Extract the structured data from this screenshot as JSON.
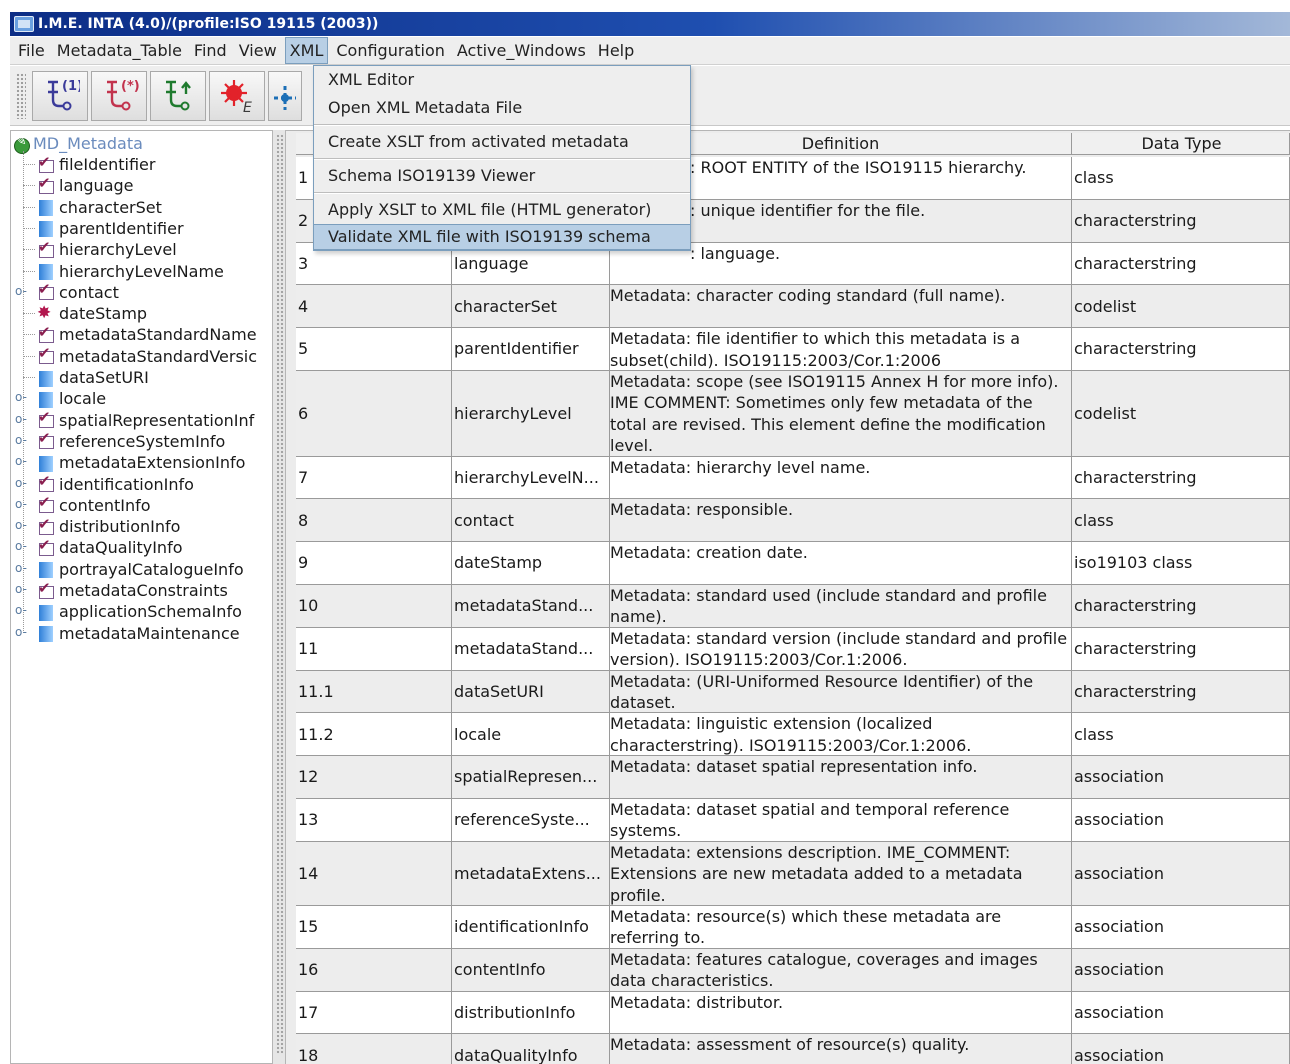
{
  "window": {
    "title": "I.M.E. INTA (4.0)/(profile:ISO 19115 (2003))"
  },
  "menubar": {
    "items": [
      "File",
      "Metadata_Table",
      "Find",
      "View",
      "XML",
      "Configuration",
      "Active_Windows",
      "Help"
    ]
  },
  "toolbar": {
    "buttons": [
      "tree-1-icon",
      "tree-star-icon",
      "tree-arrow-icon",
      "virus-e-icon",
      "network-icon"
    ]
  },
  "xml_menu": {
    "groups": [
      [
        "XML Editor",
        "Open XML Metadata File"
      ],
      [
        "Create XSLT from activated metadata"
      ],
      [
        "Schema ISO19139 Viewer"
      ],
      [
        "Apply XSLT to XML file (HTML generator)",
        "Validate XML file with ISO19139 schema"
      ]
    ],
    "highlighted": "Validate XML file with ISO19139 schema"
  },
  "tree": {
    "root": "MD_Metadata",
    "items": [
      {
        "label": "fileIdentifier",
        "icon": "check-icon",
        "expandable": false
      },
      {
        "label": "language",
        "icon": "check-icon",
        "expandable": false
      },
      {
        "label": "characterSet",
        "icon": "square-icon",
        "expandable": false
      },
      {
        "label": "parentIdentifier",
        "icon": "square-icon",
        "expandable": false
      },
      {
        "label": "hierarchyLevel",
        "icon": "check-icon",
        "expandable": false
      },
      {
        "label": "hierarchyLevelName",
        "icon": "square-icon",
        "expandable": false
      },
      {
        "label": "contact",
        "icon": "check-icon",
        "expandable": true
      },
      {
        "label": "dateStamp",
        "icon": "stamp-icon",
        "expandable": false
      },
      {
        "label": "metadataStandardName",
        "icon": "check-icon",
        "expandable": false
      },
      {
        "label": "metadataStandardVersic",
        "icon": "check-icon",
        "expandable": false
      },
      {
        "label": "dataSetURI",
        "icon": "square-icon",
        "expandable": false
      },
      {
        "label": "locale",
        "icon": "square-icon",
        "expandable": true
      },
      {
        "label": "spatialRepresentationInf",
        "icon": "check-icon",
        "expandable": true
      },
      {
        "label": "referenceSystemInfo",
        "icon": "check-icon",
        "expandable": true
      },
      {
        "label": "metadataExtensionInfo",
        "icon": "square-icon",
        "expandable": true
      },
      {
        "label": "identificationInfo",
        "icon": "check-icon",
        "expandable": true
      },
      {
        "label": "contentInfo",
        "icon": "check-icon",
        "expandable": true
      },
      {
        "label": "distributionInfo",
        "icon": "check-icon",
        "expandable": true
      },
      {
        "label": "dataQualityInfo",
        "icon": "check-icon",
        "expandable": true
      },
      {
        "label": "portrayalCatalogueInfo",
        "icon": "square-icon",
        "expandable": true
      },
      {
        "label": "metadataConstraints",
        "icon": "check-icon",
        "expandable": true
      },
      {
        "label": "applicationSchemaInfo",
        "icon": "square-icon",
        "expandable": true
      },
      {
        "label": "metadataMaintenance",
        "icon": "square-icon",
        "expandable": true
      }
    ]
  },
  "table": {
    "headers": [
      "",
      "",
      "Definition",
      "Data Type"
    ],
    "rows": [
      {
        "num": "1",
        "name": "",
        "def": ": ROOT ENTITY of the ISO19115 hierarchy.",
        "type": "class",
        "lines": 2
      },
      {
        "num": "2",
        "name": "",
        "def": ": unique identifier for the file.",
        "type": "characterstring",
        "lines": 2
      },
      {
        "num": "3",
        "name": "language",
        "def": ": language.",
        "type": "characterstring",
        "lines": 2
      },
      {
        "num": "4",
        "name": "characterSet",
        "def": "Metadata: character coding standard (full name).",
        "type": "codelist",
        "lines": 2
      },
      {
        "num": "5",
        "name": "parentIdentifier",
        "def": "Metadata: file identifier to which this metadata is a subset(child). ISO19115:2003/Cor.1:2006",
        "type": "characterstring",
        "lines": 2
      },
      {
        "num": "6",
        "name": "hierarchyLevel",
        "def": "Metadata: scope (see ISO19115 Annex H for more info). IME COMMENT: Sometimes only few metadata of the total are revised. This element define the modification level.",
        "type": "codelist",
        "lines": 4
      },
      {
        "num": "7",
        "name": "hierarchyLevelN...",
        "def": "Metadata: hierarchy level name.",
        "type": "characterstring",
        "lines": 2
      },
      {
        "num": "8",
        "name": "contact",
        "def": "Metadata: responsible.",
        "type": "class",
        "lines": 2
      },
      {
        "num": "9",
        "name": "dateStamp",
        "def": "Metadata: creation date.",
        "type": "iso19103 class",
        "lines": 2
      },
      {
        "num": "10",
        "name": "metadataStand...",
        "def": "Metadata: standard used (include standard and profile name).",
        "type": "characterstring",
        "lines": 2
      },
      {
        "num": "11",
        "name": "metadataStand...",
        "def": "Metadata: standard version (include standard and profile version). ISO19115:2003/Cor.1:2006.",
        "type": "characterstring",
        "lines": 2
      },
      {
        "num": "11.1",
        "name": "dataSetURI",
        "def": "Metadata: (URI-Uniformed Resource Identifier) of the dataset.",
        "type": "characterstring",
        "lines": 2
      },
      {
        "num": "11.2",
        "name": "locale",
        "def": "Metadata: linguistic extension (localized characterstring). ISO19115:2003/Cor.1:2006.",
        "type": "class",
        "lines": 2
      },
      {
        "num": "12",
        "name": "spatialRepresen...",
        "def": "Metadata: dataset spatial representation info.",
        "type": "association",
        "lines": 2
      },
      {
        "num": "13",
        "name": "referenceSyste...",
        "def": "Metadata: dataset spatial and temporal reference systems.",
        "type": "association",
        "lines": 2
      },
      {
        "num": "14",
        "name": "metadataExtens...",
        "def": "Metadata: extensions description. IME_COMMENT: Extensions are new metadata added to a metadata profile.",
        "type": "association",
        "lines": 3
      },
      {
        "num": "15",
        "name": "identificationInfo",
        "def": "Metadata: resource(s) which these metadata are referring to.",
        "type": "association",
        "lines": 2
      },
      {
        "num": "16",
        "name": "contentInfo",
        "def": "Metadata: features catalogue, coverages and images data characteristics.",
        "type": "association",
        "lines": 2
      },
      {
        "num": "17",
        "name": "distributionInfo",
        "def": "Metadata: distributor.",
        "type": "association",
        "lines": 2
      },
      {
        "num": "18",
        "name": "dataQualityInfo",
        "def": "Metadata: assessment of resource(s) quality.",
        "type": "association",
        "lines": 2
      }
    ]
  }
}
